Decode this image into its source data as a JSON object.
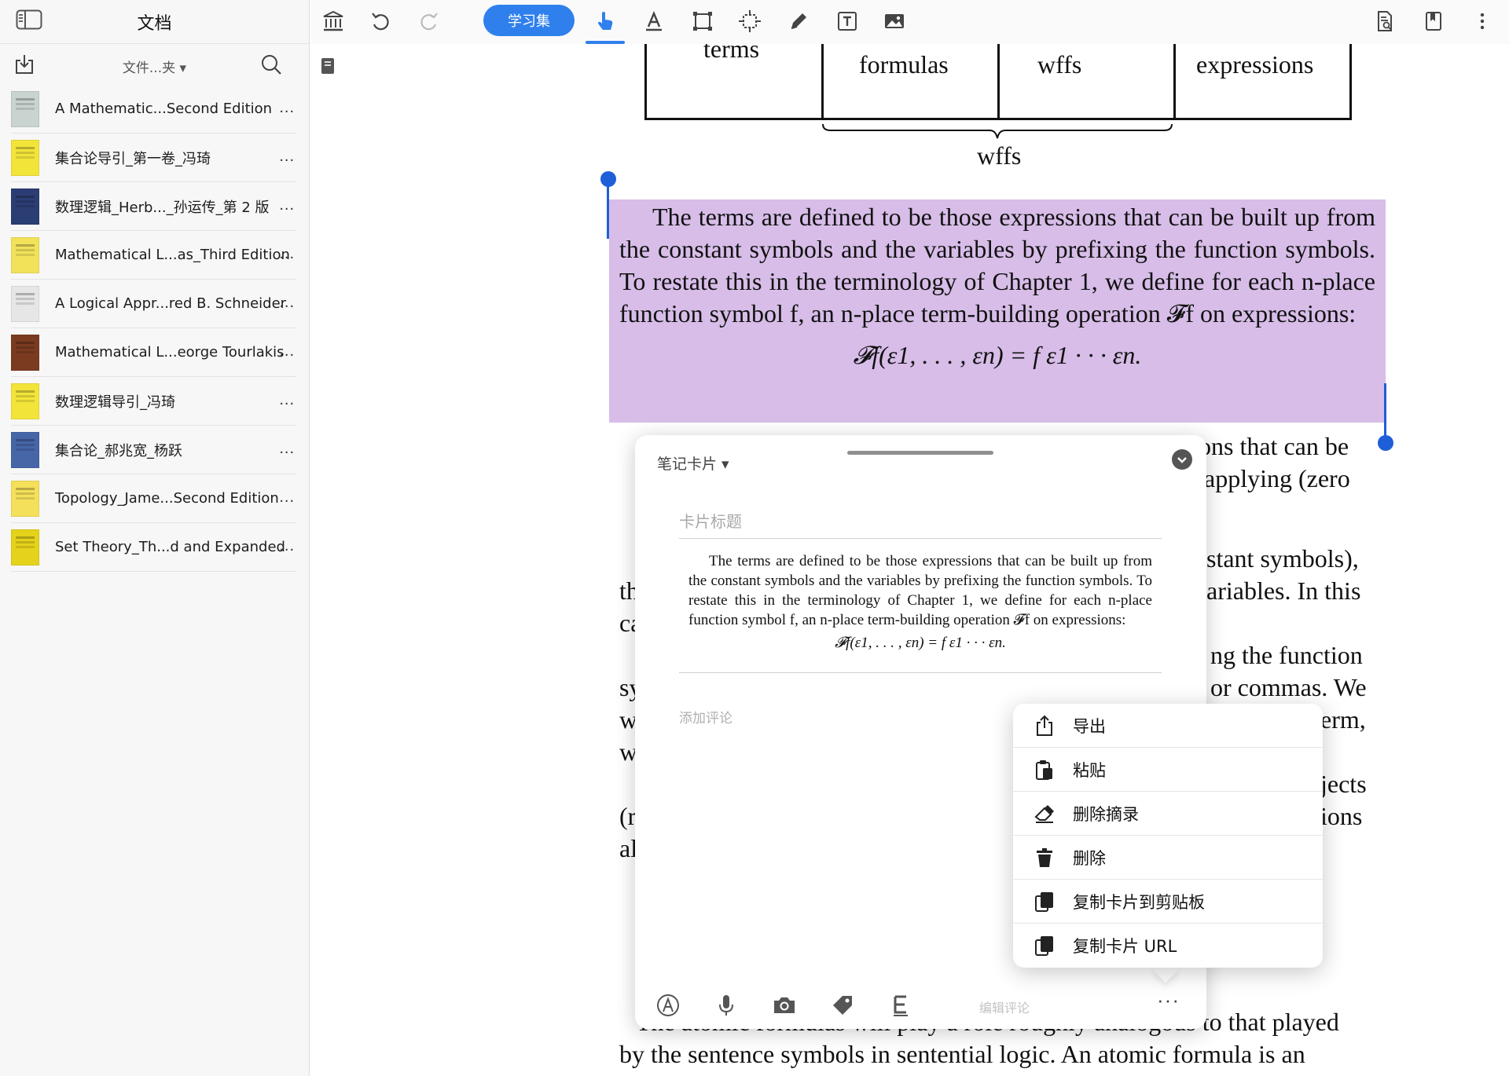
{
  "sidebar": {
    "title": "文档",
    "folder_filter": "文件...夹 ▾",
    "documents": [
      {
        "name": "A Mathematic...Second Edition",
        "thumb_color": "#c9d3cf"
      },
      {
        "name": "集合论导引_第一卷_冯琦",
        "thumb_color": "#f3e43a"
      },
      {
        "name": "数理逻辑_Herb..._孙运传_第 2 版",
        "thumb_color": "#2b3e74"
      },
      {
        "name": "Mathematical L...as_Third Edition",
        "thumb_color": "#f1e25a"
      },
      {
        "name": "A Logical Appr...red B. Schneider",
        "thumb_color": "#e6e6e6"
      },
      {
        "name": "Mathematical L...eorge Tourlakis",
        "thumb_color": "#7b3b21"
      },
      {
        "name": "数理逻辑导引_冯琦",
        "thumb_color": "#f3e43a"
      },
      {
        "name": "集合论_郝兆宽_杨跃",
        "thumb_color": "#4666a8"
      },
      {
        "name": "Topology_Jame...Second Edition",
        "thumb_color": "#f4e05a"
      },
      {
        "name": "Set Theory_Th...d and Expanded",
        "thumb_color": "#e5d21b"
      }
    ],
    "more_label": "..."
  },
  "toolbar": {
    "study_set_label": "学习集",
    "accent": "#2f80ed"
  },
  "page": {
    "box_labels": [
      "terms",
      "formulas",
      "wffs",
      "expressions"
    ],
    "brace_label": "wffs",
    "highlight_color": "#d7bde8",
    "highlighted_paragraph": "The terms are defined to be those expressions that can be built up from the constant symbols and the variables by prefixing the function symbols. To restate this in the terminology of Chapter 1, we define for each n-place function symbol f, an n-place term-building operation 𝓕f on expressions:",
    "formula": "𝓕f(ε1, . . . , εn) = f ε1 · · · εn.",
    "partial_lines": {
      "line1": "ons that can be",
      "line2": "applying (zero",
      "line3": "stant symbols),",
      "line4": "ariables. In this",
      "line5": "ng the function",
      "line6": "or commas. We",
      "line7": "erm,",
      "line8": "jects",
      "line9": "ions",
      "left1": "th",
      "left2": "ca",
      "left3": "sy",
      "left4": "w",
      "left5": "w",
      "left6": "(r",
      "left7": "al",
      "bottom1": "The atomic formulas will play a role roughly analogous to that played",
      "bottom2": "by the sentence symbols in sentential logic. An atomic formula is an"
    }
  },
  "card": {
    "type_label": "笔记卡片 ▾",
    "title_placeholder": "卡片标题",
    "excerpt": "The terms are defined to be those expressions that can be built up from the constant symbols and the variables by prefixing the function symbols. To restate this in the terminology of Chapter 1, we define for each n-place function symbol f, an n-place term-building operation 𝓕f on expressions:",
    "excerpt_formula": "𝓕f(ε1, . . . , εn) = f ε1 · · · εn.",
    "comment_placeholder": "添加评论",
    "edit_comment_label": "编辑评论",
    "more_label": "···"
  },
  "context_menu": {
    "items": [
      {
        "label": "导出",
        "icon": "share-icon"
      },
      {
        "label": "粘贴",
        "icon": "clipboard-icon"
      },
      {
        "label": "删除摘录",
        "icon": "eraser-icon"
      },
      {
        "label": "删除",
        "icon": "trash-icon"
      },
      {
        "label": "复制卡片到剪贴板",
        "icon": "copy-icon"
      },
      {
        "label": "复制卡片 URL",
        "icon": "copy-url-icon"
      }
    ]
  }
}
